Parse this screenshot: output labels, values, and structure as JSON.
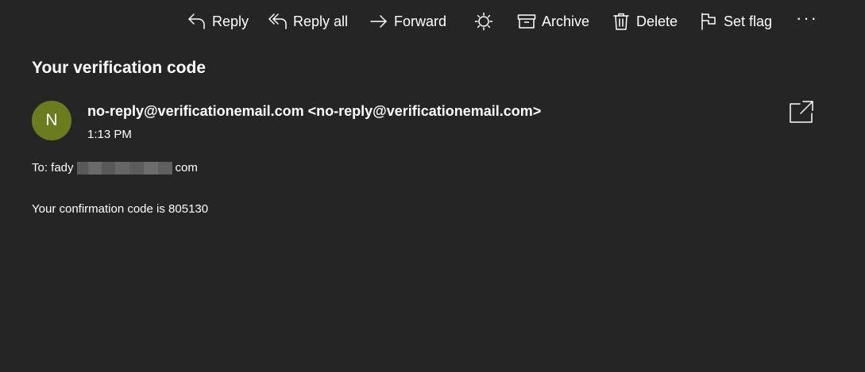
{
  "toolbar": {
    "reply_label": "Reply",
    "reply_all_label": "Reply all",
    "forward_label": "Forward",
    "archive_label": "Archive",
    "delete_label": "Delete",
    "set_flag_label": "Set flag",
    "more_label": "···"
  },
  "icons": {
    "reply": "reply-icon",
    "reply_all": "reply-all-icon",
    "forward": "forward-icon",
    "theme": "sun-icon",
    "archive": "archive-icon",
    "delete": "trash-icon",
    "flag": "flag-icon",
    "popout": "popout-icon"
  },
  "message": {
    "subject": "Your verification code",
    "avatar_initial": "N",
    "avatar_color": "#6b7c1f",
    "sender": "no-reply@verificationemail.com <no-reply@verificationemail.com>",
    "time": "1:13 PM",
    "to_prefix": "To: fady",
    "to_suffix": "com",
    "body": "Your confirmation code is 805130"
  },
  "colors": {
    "background": "#252525",
    "text": "#ffffff"
  }
}
